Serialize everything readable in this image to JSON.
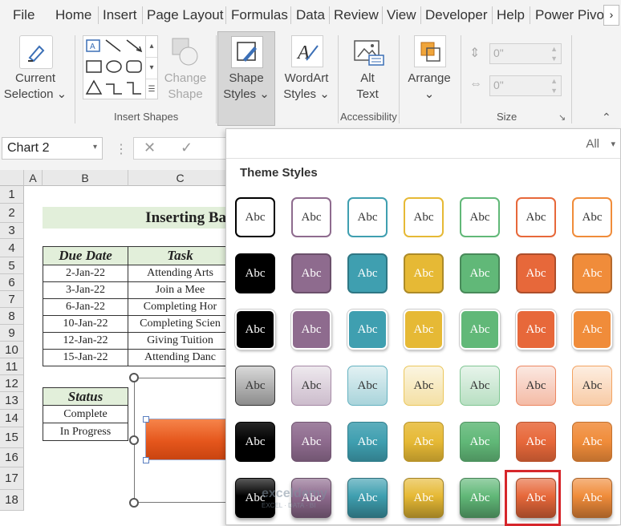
{
  "tabs": [
    "File",
    "Home",
    "Insert",
    "Page Layout",
    "Formulas",
    "Data",
    "Review",
    "View",
    "Developer",
    "Help",
    "Power Pivo"
  ],
  "ribbon": {
    "current_selection": [
      "Current",
      "Selection"
    ],
    "change_shape": [
      "Change",
      "Shape"
    ],
    "shape_styles": [
      "Shape",
      "Styles"
    ],
    "wordart_styles": [
      "WordArt",
      "Styles"
    ],
    "alt_text": [
      "Alt",
      "Text"
    ],
    "arrange": "Arrange",
    "height_value": "0\"",
    "width_value": "0\"",
    "groups": {
      "insert_shapes": "Insert Shapes",
      "accessibility": "Accessibility",
      "size": "Size"
    }
  },
  "formula_bar": {
    "name_box": "Chart 2"
  },
  "sheet": {
    "columns": [
      "A",
      "B",
      "C"
    ],
    "rows": [
      "1",
      "2",
      "3",
      "4",
      "5",
      "6",
      "7",
      "8",
      "9",
      "10",
      "11",
      "12",
      "13",
      "14",
      "15",
      "16",
      "17",
      "18"
    ],
    "title": "Inserting Ba",
    "table_headers": [
      "Due Date",
      "Task"
    ],
    "table_rows": [
      [
        "2-Jan-22",
        "Attending Arts"
      ],
      [
        "3-Jan-22",
        "Join a Mee"
      ],
      [
        "6-Jan-22",
        "Completing Hor"
      ],
      [
        "10-Jan-22",
        "Completing Scien"
      ],
      [
        "12-Jan-22",
        "Giving Tuition"
      ],
      [
        "15-Jan-22",
        "Attending Danc"
      ]
    ],
    "status_header": "Status",
    "status_rows": [
      "Complete",
      "In Progress"
    ]
  },
  "gallery": {
    "filter": "All",
    "section_title": "Theme Styles",
    "swatch_text": "Abc",
    "accent_colors": [
      "#000000",
      "#8e6b8e",
      "#3f9fb0",
      "#e6b935",
      "#61b878",
      "#e7683a",
      "#f08c3a"
    ],
    "selected": {
      "row": 6,
      "column": 6
    },
    "selection_color": "#d6262b"
  },
  "watermark": {
    "brand": "exceldemy",
    "tagline": "EXCEL · DATA · BI"
  }
}
